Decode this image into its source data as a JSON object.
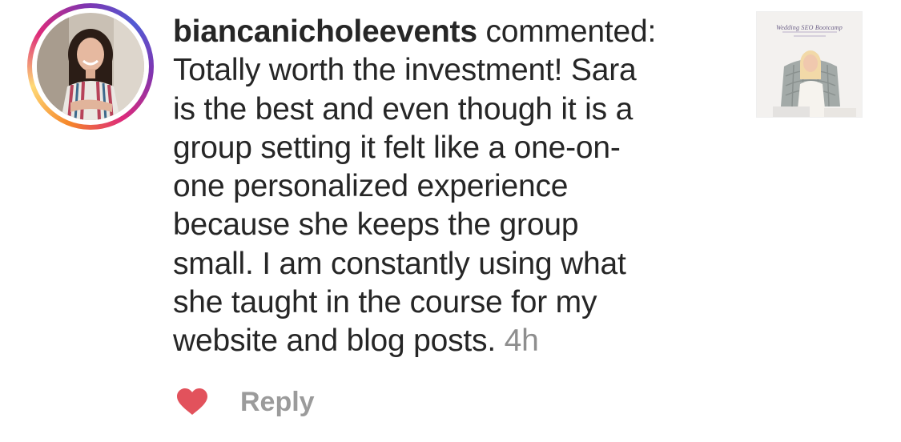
{
  "comment": {
    "username": "biancanicholeevents",
    "action": "commented:",
    "lines": [
      "Totally worth the investment! Sara",
      "is the best and even though it is a",
      "group setting it felt like a one-on-",
      "one personalized experience",
      "because she keeps the group",
      "small. I am constantly using what",
      "she taught in the course for my",
      "website and blog posts."
    ],
    "time": "4h"
  },
  "thumbnail": {
    "title": "Wedding SEO Bootcamp",
    "icon": "post-thumbnail"
  },
  "actions": {
    "like_icon": "heart-icon",
    "like_color": "#ed4956",
    "reply_label": "Reply"
  },
  "colors": {
    "text": "#262626",
    "muted": "#8e8e8e",
    "reply": "#9b9b9b"
  }
}
